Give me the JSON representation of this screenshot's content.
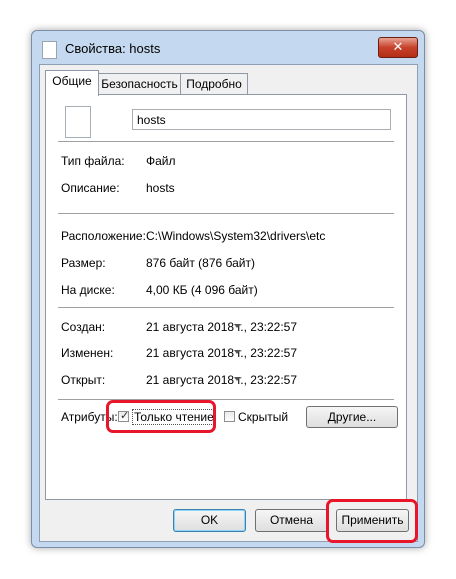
{
  "window": {
    "title": "Свойства: hosts",
    "close_label": "✕"
  },
  "tabs": [
    {
      "label": "Общие"
    },
    {
      "label": "Безопасность"
    },
    {
      "label": "Подробно"
    }
  ],
  "file": {
    "name": "hosts"
  },
  "props": {
    "type_label": "Тип файла:",
    "type_value": "Файл",
    "desc_label": "Описание:",
    "desc_value": "hosts",
    "location_label": "Расположение:",
    "location_value": "C:\\Windows\\System32\\drivers\\etc",
    "size_label": "Размер:",
    "size_value": "876 байт (876 байт)",
    "disk_label": "На диске:",
    "disk_value": "4,00 КБ (4 096 байт)",
    "created_label": "Создан:",
    "created_value": "21 августа 2018 г., 23:22:57",
    "modified_label": "Изменен:",
    "modified_value": "21 августа 2018 г., 23:22:57",
    "opened_label": "Открыт:",
    "opened_value": "21 августа 2018 г., 23:22:57"
  },
  "attributes": {
    "label": "Атрибуты:",
    "readonly_label": "Только чтение",
    "readonly_checked": true,
    "hidden_label": "Скрытый",
    "hidden_checked": false,
    "other_button": "Другие..."
  },
  "buttons": {
    "ok": "OK",
    "cancel": "Отмена",
    "apply": "Применить"
  },
  "colors": {
    "highlight": "#e8162a",
    "frame": "#c4d9ef"
  }
}
